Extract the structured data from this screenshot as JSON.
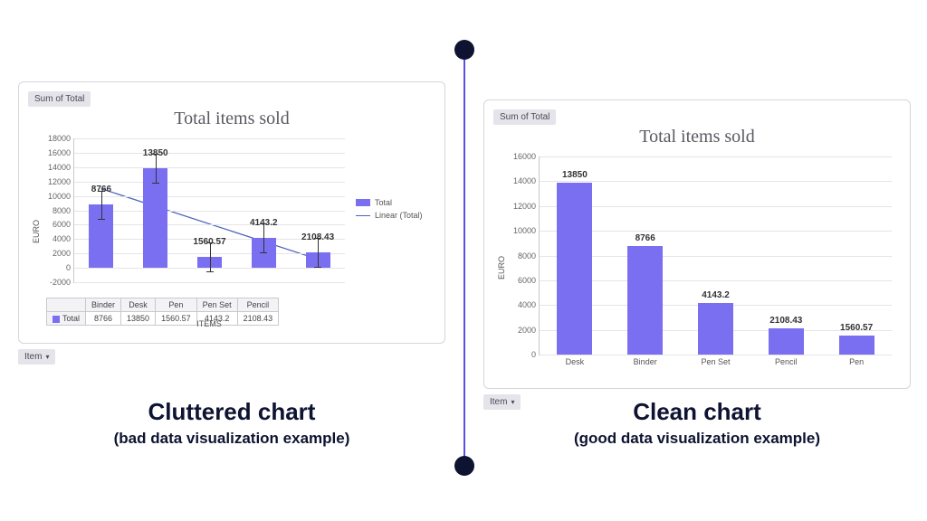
{
  "divider_color": "#5750e6",
  "dot_color": "#0d1330",
  "left": {
    "caption_title": "Cluttered chart",
    "caption_sub": "(bad data visualization example)",
    "pill_top": "Sum of Total",
    "pill_bottom": "Item",
    "chart_title": "Total items sold",
    "ylabel": "EURO",
    "xlabel": "ITEMS",
    "legend_total": "Total",
    "legend_linear": "Linear (Total)",
    "table_header": "Total"
  },
  "right": {
    "caption_title": "Clean chart",
    "caption_sub": "(good data visualization example)",
    "pill_top": "Sum of Total",
    "pill_bottom": "Item",
    "chart_title": "Total items sold",
    "ylabel": "EURO"
  },
  "chart_data": [
    {
      "id": "cluttered",
      "type": "bar",
      "title": "Total items sold",
      "xlabel": "ITEMS",
      "ylabel": "EURO",
      "ylim": [
        -2000,
        18000
      ],
      "yticks": [
        -2000,
        0,
        2000,
        4000,
        6000,
        8000,
        10000,
        12000,
        14000,
        16000,
        18000
      ],
      "categories": [
        "Binder",
        "Desk",
        "Pen",
        "Pen Set",
        "Pencil"
      ],
      "series": [
        {
          "name": "Total",
          "values": [
            8766,
            13850,
            1560.57,
            4143.2,
            2108.43
          ]
        }
      ],
      "trendline": {
        "name": "Linear (Total)",
        "points": [
          [
            0,
            11000
          ],
          [
            4,
            1200
          ]
        ]
      },
      "error_bars_approx": 2000,
      "legend": [
        "Total",
        "Linear (Total)"
      ],
      "data_table": {
        "row_header": "Total",
        "cells": [
          8766,
          13850,
          1560.57,
          4143.2,
          2108.43
        ]
      }
    },
    {
      "id": "clean",
      "type": "bar",
      "title": "Total items sold",
      "xlabel": "",
      "ylabel": "EURO",
      "ylim": [
        0,
        16000
      ],
      "yticks": [
        0,
        2000,
        4000,
        6000,
        8000,
        10000,
        12000,
        14000,
        16000
      ],
      "categories": [
        "Desk",
        "Binder",
        "Pen Set",
        "Pencil",
        "Pen"
      ],
      "series": [
        {
          "name": "Total",
          "values": [
            13850,
            8766,
            4143.2,
            2108.43,
            1560.57
          ]
        }
      ]
    }
  ]
}
